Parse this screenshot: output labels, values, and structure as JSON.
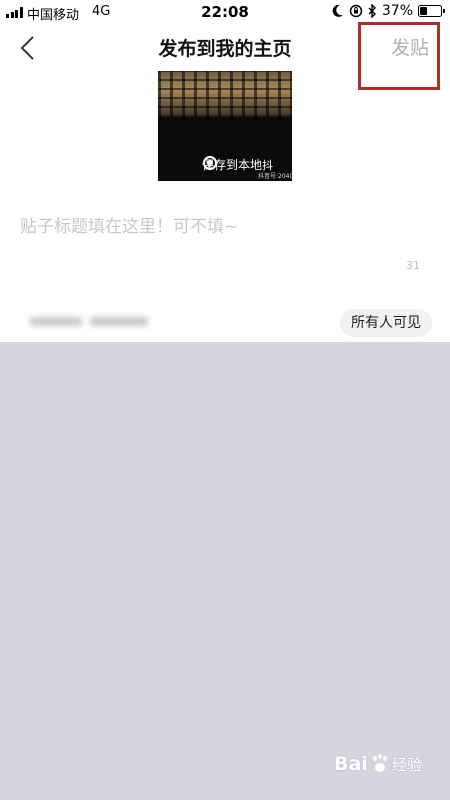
{
  "status_bar": {
    "carrier": "中国移动",
    "network": "4G",
    "time": "22:08",
    "battery_percent": "37%",
    "battery_level": 0.37
  },
  "nav": {
    "title": "发布到我的主页",
    "publish_label": "发贴"
  },
  "media": {
    "save_label": "保存到本地",
    "brand_mark": "抖",
    "id_label": "抖音号:204059"
  },
  "post": {
    "title_placeholder": "贴子标题填在这里！可不填~",
    "char_count": "31"
  },
  "visibility": {
    "label": "所有人可见"
  },
  "watermark": {
    "text": "Bai",
    "suffix": "经验"
  },
  "colors": {
    "highlight_border": "#a8302a",
    "panel_background": "#d5d5e0"
  }
}
